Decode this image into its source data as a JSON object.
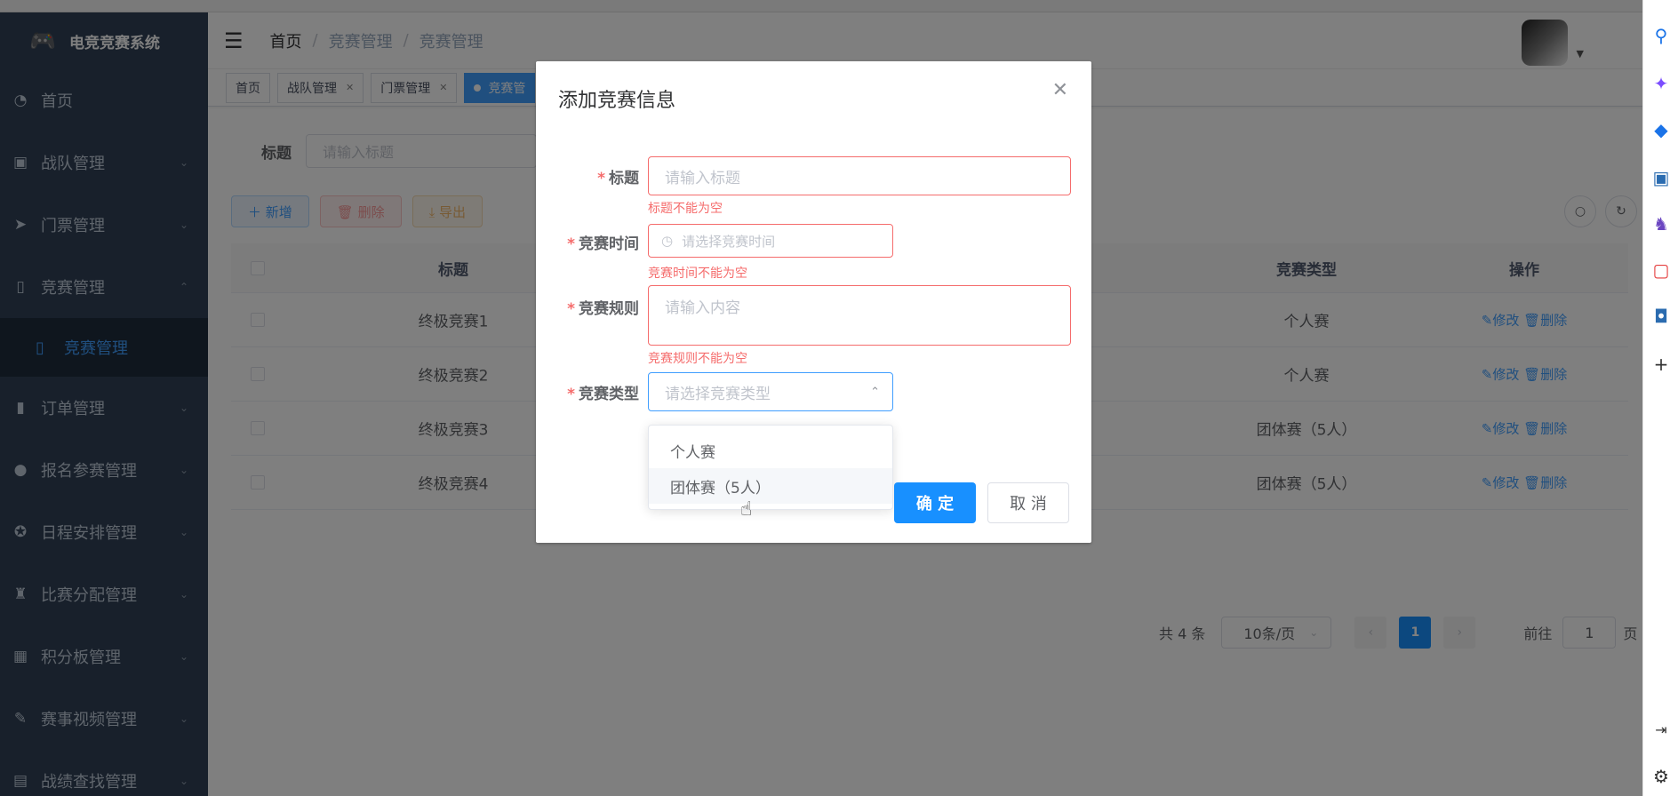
{
  "app": {
    "title": "电竞竞赛系统",
    "logo_icon": "gamepad-icon"
  },
  "sidebar": {
    "items": [
      {
        "label": "首页",
        "icon": "dashboard-icon"
      },
      {
        "label": "战队管理",
        "icon": "id-card-icon"
      },
      {
        "label": "门票管理",
        "icon": "paper-plane-icon"
      },
      {
        "label": "竞赛管理",
        "icon": "book-icon"
      },
      {
        "label": "订单管理",
        "icon": "bar-chart-icon"
      },
      {
        "label": "报名参赛管理",
        "icon": "globe-icon"
      },
      {
        "label": "日程安排管理",
        "icon": "lifebuoy-icon"
      },
      {
        "label": "比赛分配管理",
        "icon": "tshirt-icon"
      },
      {
        "label": "积分板管理",
        "icon": "clapperboard-icon"
      },
      {
        "label": "赛事视频管理",
        "icon": "edit-icon"
      },
      {
        "label": "战绩查找管理",
        "icon": "table-icon"
      }
    ],
    "sub_item": {
      "label": "竞赛管理",
      "icon": "book-icon"
    }
  },
  "navbar": {
    "breadcrumb": [
      "首页",
      "竞赛管理",
      "竞赛管理"
    ],
    "separator": "/"
  },
  "tags": [
    {
      "label": "首页"
    },
    {
      "label": "战队管理"
    },
    {
      "label": "门票管理"
    },
    {
      "label": "竞赛管"
    }
  ],
  "search": {
    "label": "标题",
    "placeholder": "请输入标题"
  },
  "toolbar": {
    "add": "＋ 新增",
    "delete": "🗑 删除",
    "export": "⤓ 导出"
  },
  "table": {
    "headers": {
      "title": "标题",
      "type": "竞赛类型",
      "ops": "操作"
    },
    "rows": [
      {
        "title": "终极竞赛1",
        "type": "个人赛"
      },
      {
        "title": "终极竞赛2",
        "type": "个人赛"
      },
      {
        "title": "终极竞赛3",
        "type": "团体赛（5人）"
      },
      {
        "title": "终极竞赛4",
        "type": "团体赛（5人）"
      }
    ],
    "edit_label": "✎修改",
    "delete_label": "🗑删除"
  },
  "pagination": {
    "total": "共 4 条",
    "page_size": "10条/页",
    "current": "1",
    "goto_prefix": "前往",
    "goto_value": "1",
    "goto_suffix": "页"
  },
  "dialog": {
    "title": "添加竞赛信息",
    "fields": {
      "title": {
        "label": "标题",
        "placeholder": "请输入标题",
        "error": "标题不能为空"
      },
      "time": {
        "label": "竞赛时间",
        "placeholder": "请选择竞赛时间",
        "error": "竞赛时间不能为空"
      },
      "rules": {
        "label": "竞赛规则",
        "placeholder": "请输入内容",
        "error": "竞赛规则不能为空"
      },
      "type": {
        "label": "竞赛类型",
        "placeholder": "请选择竞赛类型"
      }
    },
    "required_mark": "*",
    "options": [
      "个人赛",
      "团体赛（5人）"
    ],
    "ok": "确 定",
    "cancel": "取 消"
  },
  "colors": {
    "primary": "#1890ff",
    "danger": "#f56c6c",
    "sidebar_bg": "#304156"
  }
}
